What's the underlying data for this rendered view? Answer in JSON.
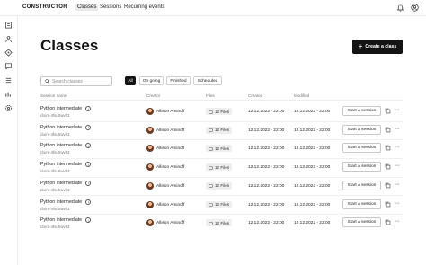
{
  "app": {
    "logo": "CONSTRUCTOR"
  },
  "nav": {
    "tabs": [
      {
        "label": "Classes"
      },
      {
        "label": "Sessions"
      },
      {
        "label": "Recurring events"
      }
    ]
  },
  "page": {
    "title": "Classes",
    "create_button": "Create a class",
    "create_icon": "+"
  },
  "search": {
    "placeholder": "Search classes",
    "value": ""
  },
  "filters": [
    {
      "label": "All"
    },
    {
      "label": "On going"
    },
    {
      "label": "Finished"
    },
    {
      "label": "Scheduled"
    }
  ],
  "table": {
    "columns": [
      "Session name",
      "Creator",
      "Files",
      "Created",
      "Modified"
    ],
    "rows": [
      {
        "name": "Python intermediate",
        "code": "clxim-4fsu0wvb3",
        "creator": "Allison Aminoff",
        "files": "12 Files",
        "created": "12.12.2022 - 22:00",
        "modified": "12.12.2022 - 22:00",
        "action": "Start a session"
      },
      {
        "name": "Python intermediate",
        "code": "clxim-4fsu0wvb3",
        "creator": "Allison Aminoff",
        "files": "12 Files",
        "created": "12.12.2022 - 22:00",
        "modified": "12.12.2022 - 22:00",
        "action": "Start a session"
      },
      {
        "name": "Python intermediate",
        "code": "clxim-4fsu0wvb3",
        "creator": "Allison Aminoff",
        "files": "12 Files",
        "created": "12.12.2022 - 22:00",
        "modified": "12.12.2022 - 22:00",
        "action": "Start a session"
      },
      {
        "name": "Python intermediate",
        "code": "clxim-4fsu0wvb3",
        "creator": "Allison Aminoff",
        "files": "12 Files",
        "created": "12.12.2022 - 22:00",
        "modified": "12.12.2022 - 22:00",
        "action": "Start a session"
      },
      {
        "name": "Python intermediate",
        "code": "clxim-4fsu0wvb3",
        "creator": "Allison Aminoff",
        "files": "12 Files",
        "created": "12.12.2022 - 22:00",
        "modified": "12.12.2022 - 22:00",
        "action": "Start a session"
      },
      {
        "name": "Python intermediate",
        "code": "clxim-4fsu0wvb3",
        "creator": "Allison Aminoff",
        "files": "12 Files",
        "created": "12.12.2022 - 22:00",
        "modified": "12.12.2022 - 22:00",
        "action": "Start a session"
      },
      {
        "name": "Python intermediate",
        "code": "clxim-4fsu0wvb3",
        "creator": "Allison Aminoff",
        "files": "12 Files",
        "created": "12.12.2022 - 22:00",
        "modified": "12.12.2022 - 22:00",
        "action": "Start a session"
      }
    ]
  },
  "icons": {
    "sidebar": [
      "building-icon",
      "people-icon",
      "target-icon",
      "chat-icon",
      "list-icon",
      "chart-icon",
      "settings-icon"
    ],
    "topbar": [
      "bell-icon",
      "user-icon"
    ],
    "row": [
      "info-icon",
      "folder-icon",
      "copy-icon",
      "more-icon"
    ]
  },
  "colors": {
    "primary": "#141414",
    "border": "#c8c8c8",
    "muted": "#777777",
    "chip_bg": "#eeeeee"
  }
}
